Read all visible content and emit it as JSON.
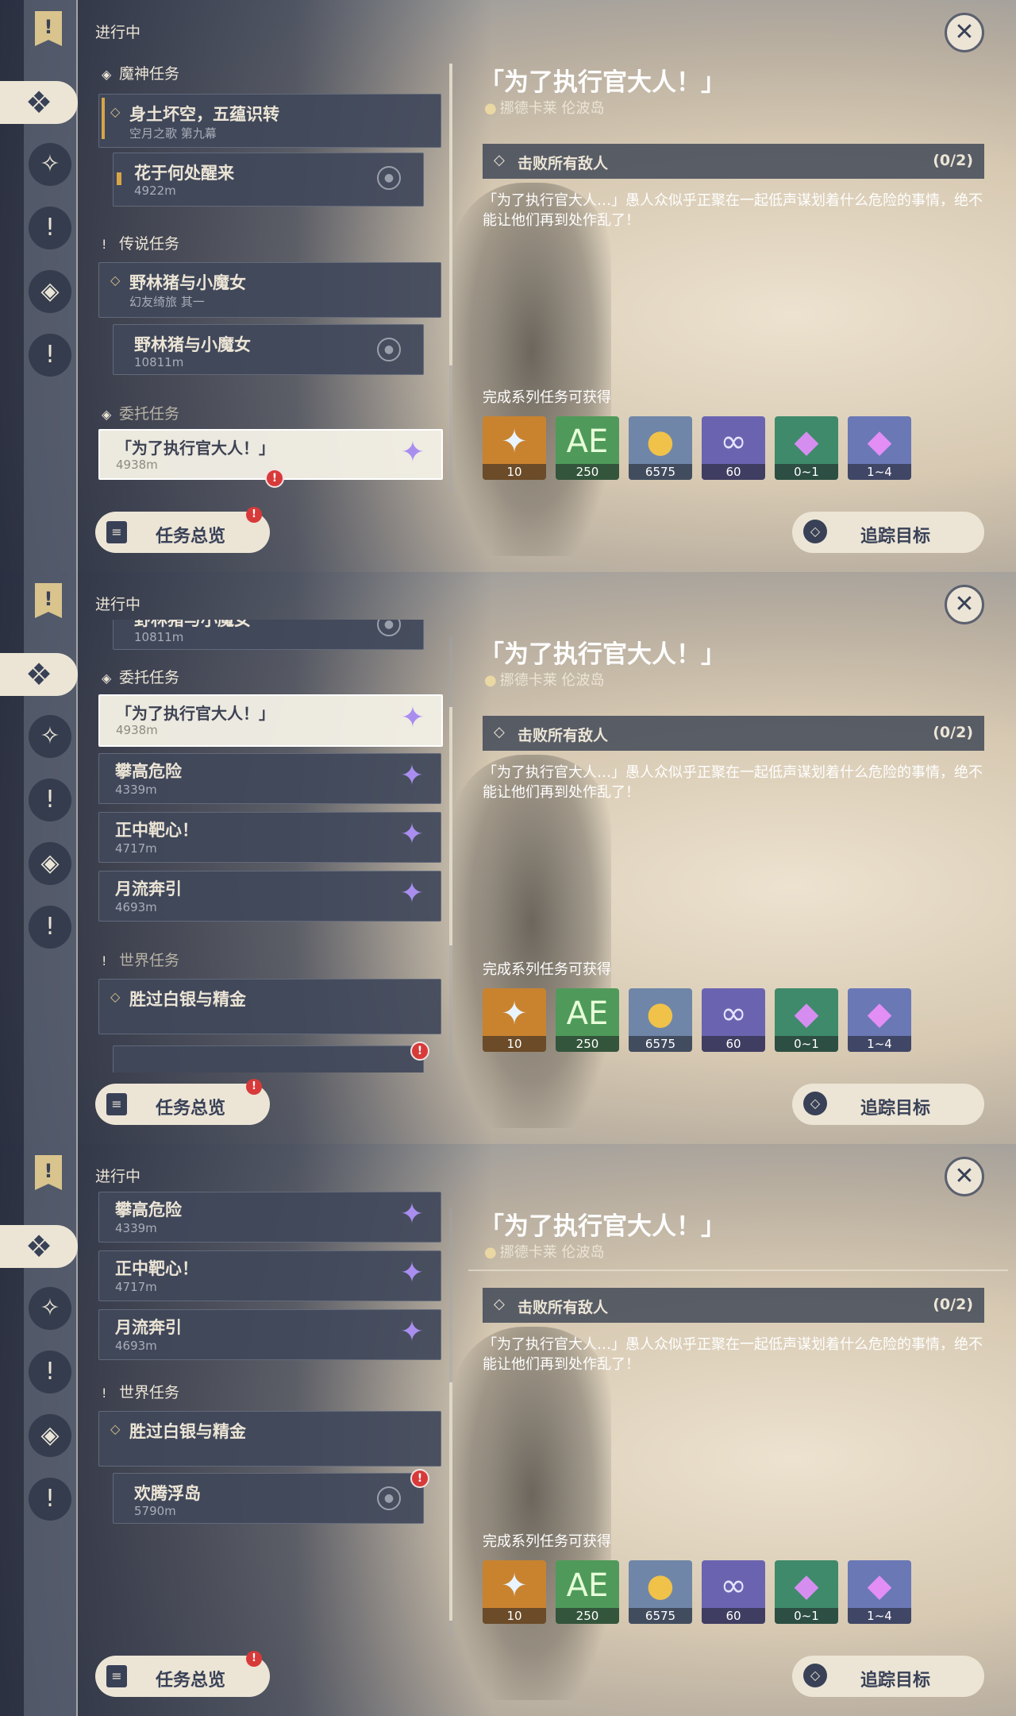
{
  "common": {
    "in_progress": "进行中",
    "overview": "任务总览",
    "track": "追踪目标",
    "alert_mark": "!",
    "quest": {
      "title": "「为了执行官大人！」",
      "location": "挪德卡莱 伦波岛",
      "objective": "击败所有敌人",
      "progress": "(0/2)",
      "description": "「为了执行官大人…」愚人众似乎正聚在一起低声谋划着什么危险的事情，绝不能让他们再到处作乱了！"
    },
    "rewards_label": "完成系列任务可获得",
    "rewards": [
      {
        "name": "primogem-icon",
        "qty": "10",
        "bg": "#c9832f"
      },
      {
        "name": "adventure-exp-icon",
        "qty": "250",
        "bg": "#4f9a5a"
      },
      {
        "name": "mora-icon",
        "qty": "6575",
        "bg": "#6f86a8"
      },
      {
        "name": "companionship-exp-icon",
        "qty": "60",
        "bg": "#6a64b0"
      },
      {
        "name": "crystal-green-icon",
        "qty": "0~1",
        "bg": "#3f8a6a"
      },
      {
        "name": "crystal-purple-icon",
        "qty": "1~4",
        "bg": "#6a78b5"
      }
    ]
  },
  "panel1": {
    "sec_archon": "魔神任务",
    "archon_head": {
      "title": "身土坏空，五蕴识转",
      "subtitle": "空月之歌 第九幕"
    },
    "archon_step": {
      "title": "花于何处醒来",
      "distance": "4922m"
    },
    "sec_legend": "传说任务",
    "legend_head": {
      "title": "野林猪与小魔女",
      "subtitle": "幻友绮旅 其一"
    },
    "legend_step": {
      "title": "野林猪与小魔女",
      "distance": "10811m"
    },
    "sec_commission": "委托任务",
    "selected": {
      "title": "「为了执行官大人！」",
      "distance": "4938m"
    }
  },
  "panel2": {
    "legend_step": {
      "title": "野林猪与小魔女",
      "distance": "10811m"
    },
    "sec_commission": "委托任务",
    "selected": {
      "title": "「为了执行官大人！」",
      "distance": "4938m"
    },
    "commissions": [
      {
        "title": "攀高危险",
        "distance": "4339m"
      },
      {
        "title": "正中靶心！",
        "distance": "4717m"
      },
      {
        "title": "月流奔引",
        "distance": "4693m"
      }
    ],
    "sec_world": "世界任务",
    "world_head": {
      "title": "胜过白银与精金"
    }
  },
  "panel3": {
    "commissions": [
      {
        "title": "攀高危险",
        "distance": "4339m"
      },
      {
        "title": "正中靶心！",
        "distance": "4717m"
      },
      {
        "title": "月流奔引",
        "distance": "4693m"
      }
    ],
    "sec_world": "世界任务",
    "world_head": {
      "title": "胜过白银与精金"
    },
    "world_step": {
      "title": "欢腾浮岛",
      "distance": "5790m"
    }
  }
}
